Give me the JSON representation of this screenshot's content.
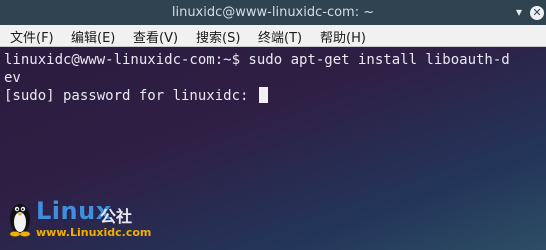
{
  "window": {
    "title": "linuxidc@www-linuxidc-com: ~",
    "buttons": {
      "menu_icon": "chevron-down-icon",
      "close_icon": "close-icon"
    }
  },
  "menubar": {
    "items": [
      {
        "label": "文件(F)"
      },
      {
        "label": "编辑(E)"
      },
      {
        "label": "查看(V)"
      },
      {
        "label": "搜索(S)"
      },
      {
        "label": "终端(T)"
      },
      {
        "label": "帮助(H)"
      }
    ]
  },
  "terminal": {
    "lines": [
      "linuxidc@www-linuxidc-com:~$ sudo apt-get install liboauth-d",
      "ev",
      "[sudo] password for linuxidc: "
    ],
    "colors": {
      "text": "#e9e9f2",
      "cursor": "#f1f1f1"
    }
  },
  "watermark": {
    "brand": "Linux",
    "suffix": "公社",
    "url": "www.Linuxidc.com",
    "brand_color": "#3f8ee0",
    "url_color": "#f0b000"
  }
}
